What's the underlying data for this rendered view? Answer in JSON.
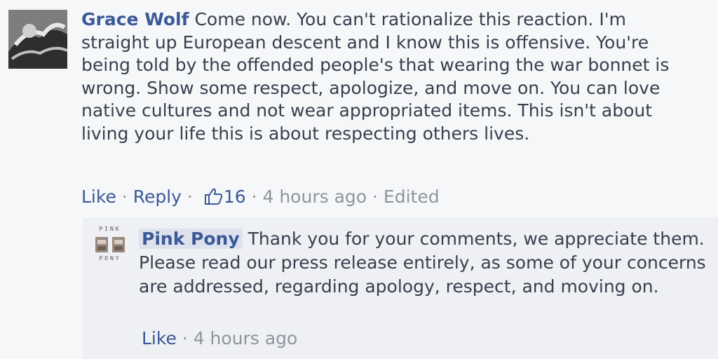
{
  "comment": {
    "author": "Grace Wolf",
    "text": "Come now. You can't rationalize this reaction. I'm straight up European descent and I know this is offensive. You're being told by the offended people's that wearing the war bonnet is wrong. Show some respect, apologize, and move on. You can love native cultures and not wear appropriated items. This isn't about living your life this is about respecting others lives.",
    "like_label": "Like",
    "reply_label": "Reply",
    "like_count": "16",
    "time": "4 hours ago",
    "edited_label": "Edited",
    "separator": "·"
  },
  "reply": {
    "author": "Pink Pony",
    "avatar_top_text": "PINK",
    "avatar_bottom_text": "PONY",
    "text": "Thank you for your comments, we appreciate them. Please read our press release entirely, as some of your concerns are addressed, regarding apology, respect, and moving on.",
    "like_label": "Like",
    "time": "4 hours ago",
    "separator": "·"
  },
  "colors": {
    "link": "#3b5998",
    "text": "#37404e",
    "meta": "#90949c",
    "background": "#f6f7f9",
    "reply_background": "#eef0f4"
  }
}
